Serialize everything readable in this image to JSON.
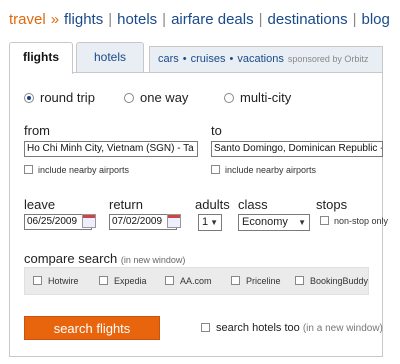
{
  "nav": {
    "travel": "travel",
    "arrow": "»",
    "items": [
      "flights",
      "hotels",
      "airfare deals",
      "destinations",
      "blog"
    ],
    "sep": "|"
  },
  "tabs": {
    "flights": "flights",
    "hotels": "hotels",
    "cars": "cars",
    "cruises": "cruises",
    "vacations": "vacations",
    "dot": "•",
    "sponsored": "sponsored by Orbitz"
  },
  "trip_type": {
    "options": [
      "round trip",
      "one way",
      "multi-city"
    ],
    "selected": "round trip"
  },
  "from": {
    "label": "from",
    "value": "Ho Chi Minh City, Vietnam (SGN) - Ta",
    "nearby": "include nearby airports"
  },
  "to": {
    "label": "to",
    "value": "Santo Domingo, Dominican Republic -",
    "nearby": "include nearby airports"
  },
  "leave": {
    "label": "leave",
    "value": "06/25/2009"
  },
  "return": {
    "label": "return",
    "value": "07/02/2009"
  },
  "adults": {
    "label": "adults",
    "value": "1"
  },
  "class": {
    "label": "class",
    "value": "Economy"
  },
  "stops": {
    "label": "stops",
    "nonstop": "non-stop only"
  },
  "compare": {
    "label": "compare search",
    "hint": "(in new window)",
    "sites": [
      "Hotwire",
      "Expedia",
      "AA.com",
      "Priceline",
      "BookingBuddy"
    ]
  },
  "search_button": "search flights",
  "search_hotels": {
    "label": "search hotels too",
    "hint": "(in a new window)"
  },
  "colors": {
    "accent": "#e8650e",
    "link": "#1a4a8a",
    "tab_bg": "#e9eef4"
  }
}
